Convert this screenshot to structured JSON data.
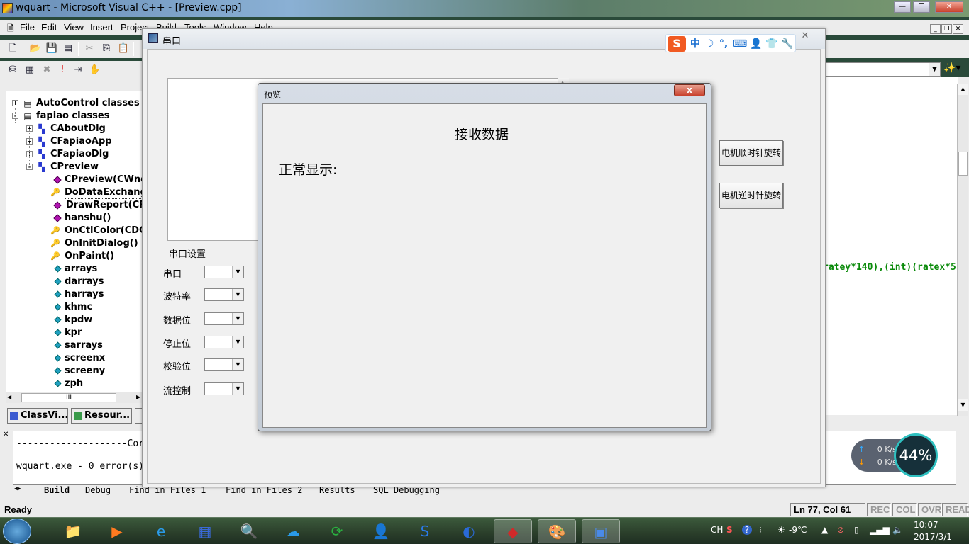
{
  "vc_window": {
    "title": "wquart - Microsoft Visual C++ - [Preview.cpp]",
    "menu": [
      {
        "label": "File",
        "key": "F"
      },
      {
        "label": "Edit",
        "key": "E"
      },
      {
        "label": "View",
        "key": "V"
      },
      {
        "label": "Insert",
        "key": "I"
      },
      {
        "label": "Project",
        "key": "P"
      },
      {
        "label": "Build",
        "key": "B"
      },
      {
        "label": "Tools",
        "key": "T"
      },
      {
        "label": "Window",
        "key": "W"
      },
      {
        "label": "Help",
        "key": "H"
      }
    ]
  },
  "class_tree": {
    "items": [
      {
        "label": "AutoControl classes",
        "kind": "folder",
        "expand": "+"
      },
      {
        "label": "fapiao classes",
        "kind": "folder",
        "expand": "-"
      },
      {
        "label": "CAboutDlg",
        "kind": "class",
        "expand": "+"
      },
      {
        "label": "CFapiaoApp",
        "kind": "class",
        "expand": "+"
      },
      {
        "label": "CFapiaoDlg",
        "kind": "class",
        "expand": "+"
      },
      {
        "label": "CPreview",
        "kind": "class",
        "expand": "-"
      },
      {
        "label": "CPreview(CWnd",
        "kind": "fn"
      },
      {
        "label": "DoDataExchange",
        "kind": "key"
      },
      {
        "label": "DrawReport(CRe",
        "kind": "fn",
        "selected": true
      },
      {
        "label": "hanshu()",
        "kind": "fn"
      },
      {
        "label": "OnCtlColor(CDC *",
        "kind": "key"
      },
      {
        "label": "OnInitDialog()",
        "kind": "key"
      },
      {
        "label": "OnPaint()",
        "kind": "key"
      },
      {
        "label": "arrays",
        "kind": "var"
      },
      {
        "label": "darrays",
        "kind": "var"
      },
      {
        "label": "harrays",
        "kind": "var"
      },
      {
        "label": "khmc",
        "kind": "var"
      },
      {
        "label": "kpdw",
        "kind": "var"
      },
      {
        "label": "kpr",
        "kind": "var"
      },
      {
        "label": "sarrays",
        "kind": "var"
      },
      {
        "label": "screenx",
        "kind": "var"
      },
      {
        "label": "screeny",
        "kind": "var"
      },
      {
        "label": "zph",
        "kind": "var"
      }
    ],
    "scroll_label": "III"
  },
  "workspace_tabs": [
    {
      "label": "ClassVi..."
    },
    {
      "label": "Resour..."
    }
  ],
  "code": {
    "visible_line": "ratey*140),(int)(ratex*5"
  },
  "output": {
    "line1": "--------------------Cor",
    "line2": "wquart.exe - 0 error(s)",
    "tabs": [
      "Build",
      "Debug",
      "Find in Files 1",
      "Find in Files 2",
      "Results",
      "SQL Debugging"
    ]
  },
  "status": {
    "text": "Ready",
    "position": "Ln 77, Col 61",
    "indicators": [
      "REC",
      "COL",
      "OVR",
      "READ"
    ]
  },
  "serial_dialog": {
    "title": "串口",
    "settings_group": "串口设置",
    "fields": [
      {
        "label": "串口"
      },
      {
        "label": "波特率"
      },
      {
        "label": "数据位"
      },
      {
        "label": "停止位"
      },
      {
        "label": "校验位"
      },
      {
        "label": "流控制"
      }
    ],
    "btn_cw": "电机顺时针旋转",
    "btn_ccw": "电机逆时针旋转"
  },
  "ime": {
    "logo": "S",
    "mode": "中",
    "items": [
      "☽",
      "°,",
      "⌨",
      "👤",
      "👕",
      "🔧"
    ]
  },
  "preview_dialog": {
    "title": "预览",
    "close_label": "x",
    "heading": "接收数据",
    "subheading": "正常显示:"
  },
  "net_widget": {
    "up": "0 K/s",
    "down": "0 K/s",
    "percent": "44%"
  },
  "taskbar": {
    "apps": [
      "📁",
      "▶",
      "e",
      "▦",
      "🔍",
      "☁",
      "⟳",
      "👤",
      "S",
      "◐",
      "◆",
      "🎨",
      "▣"
    ],
    "tray": [
      "CH",
      "?",
      "-9℃"
    ],
    "time": "10:07",
    "date": "2017/3/1"
  },
  "colors": {
    "code_green": "#0a8a0a",
    "ime_orange": "#f15a22",
    "gauge_ring": "#2ec0c0"
  }
}
